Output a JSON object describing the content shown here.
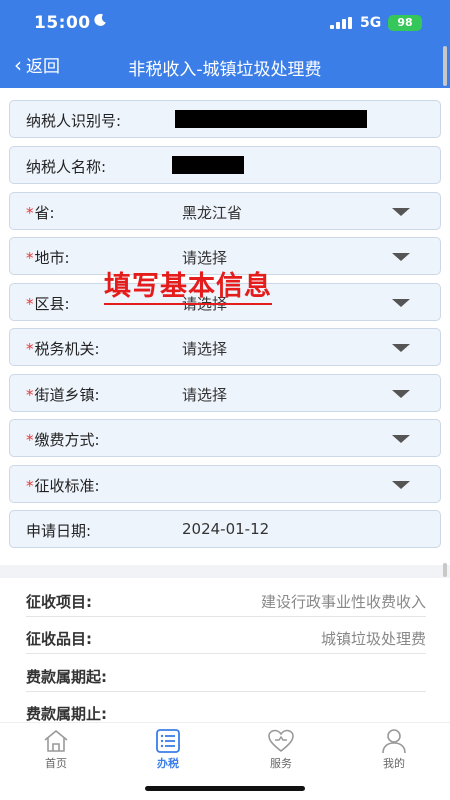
{
  "status_bar": {
    "time": "15:00",
    "network": "5G",
    "battery": "98"
  },
  "nav": {
    "back_label": "返回",
    "title": "非税收入-城镇垃圾处理费"
  },
  "form": {
    "taxpayer_id": {
      "label": "纳税人识别号:"
    },
    "taxpayer_name": {
      "label": "纳税人名称:"
    },
    "province": {
      "label": "省:",
      "value": "黑龙江省"
    },
    "city": {
      "label": "地市:",
      "value": "请选择"
    },
    "county": {
      "label": "区县:",
      "value": "请选择"
    },
    "tax_office": {
      "label": "税务机关:",
      "value": "请选择"
    },
    "street": {
      "label": "街道乡镇:",
      "value": "请选择"
    },
    "payment_method": {
      "label": "缴费方式:"
    },
    "levy_standard": {
      "label": "征收标准:"
    },
    "apply_date": {
      "label": "申请日期:",
      "value": "2024-01-12"
    },
    "required_mark": "*"
  },
  "annotation": "填写基本信息",
  "info": {
    "levy_item": {
      "label": "征收项目:",
      "value": "建设行政事业性收费收入"
    },
    "levy_subitem": {
      "label": "征收品目:",
      "value": "城镇垃圾处理费"
    },
    "period_start": {
      "label": "费款属期起:"
    },
    "period_end": {
      "label": "费款属期止:"
    }
  },
  "tabs": [
    {
      "label": "首页",
      "icon": "home-icon"
    },
    {
      "label": "办税",
      "icon": "list-icon",
      "active": true
    },
    {
      "label": "服务",
      "icon": "heart-icon"
    },
    {
      "label": "我的",
      "icon": "person-icon"
    }
  ],
  "colors": {
    "primary": "#3b7ee8",
    "required": "#e53935",
    "annotation": "#e51c1c",
    "battery": "#35c759"
  }
}
